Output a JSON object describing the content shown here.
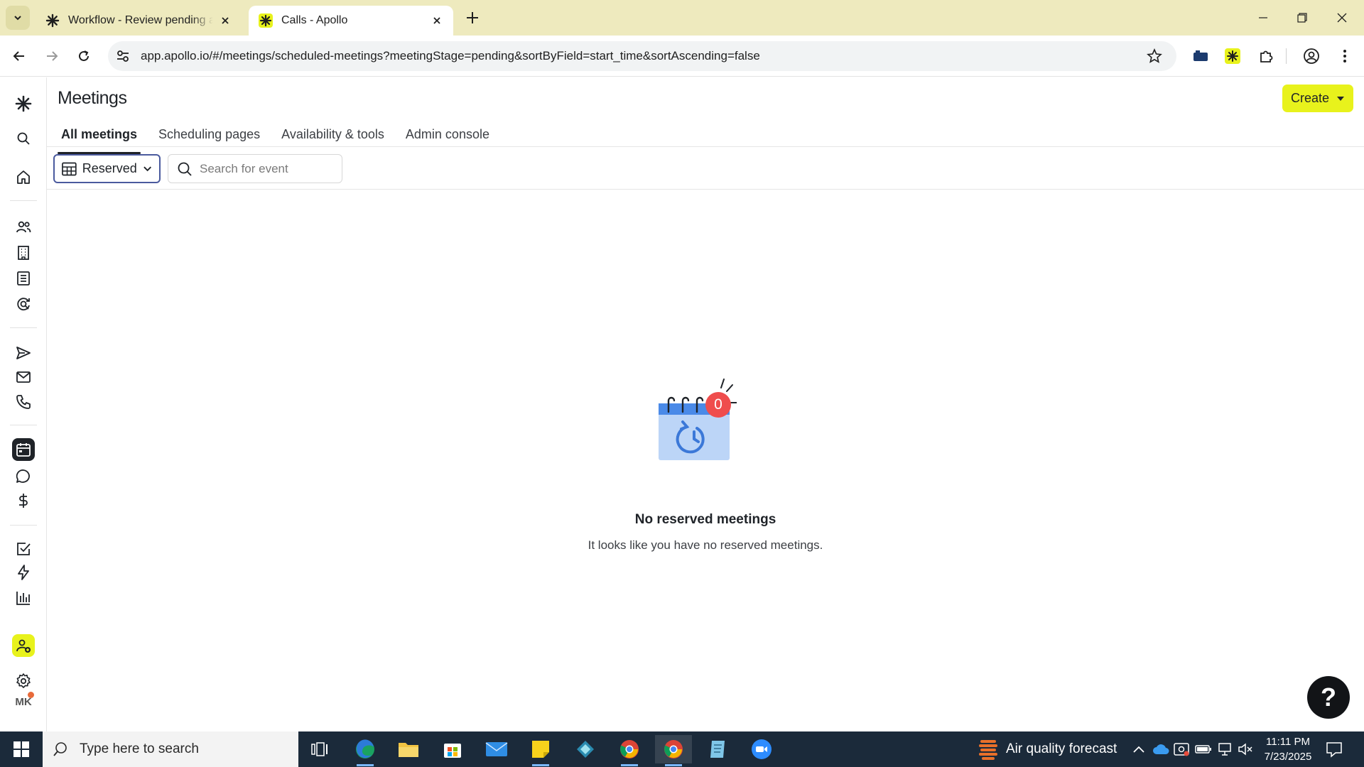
{
  "browser": {
    "tabs": [
      {
        "title": "Workflow - Review pending app",
        "active": false
      },
      {
        "title": "Calls - Apollo",
        "active": true
      }
    ],
    "url": "app.apollo.io/#/meetings/scheduled-meetings?meetingStage=pending&sortByField=start_time&sortAscending=false"
  },
  "sidebar": {
    "items": [
      {
        "icon": "apollo-logo-icon"
      },
      {
        "icon": "search-icon"
      },
      {
        "icon": "home-icon"
      },
      {
        "icon": "people-icon"
      },
      {
        "icon": "companies-icon"
      },
      {
        "icon": "lists-icon"
      },
      {
        "icon": "data-enrichment-icon"
      },
      {
        "icon": "sequences-icon"
      },
      {
        "icon": "emails-icon"
      },
      {
        "icon": "calls-icon"
      },
      {
        "icon": "meetings-icon",
        "active": true
      },
      {
        "icon": "conversations-icon"
      },
      {
        "icon": "deals-icon"
      },
      {
        "icon": "tasks-icon"
      },
      {
        "icon": "workflows-icon"
      },
      {
        "icon": "analytics-icon"
      },
      {
        "icon": "invite-user-icon"
      },
      {
        "icon": "settings-icon"
      }
    ],
    "avatar_initials": "MK"
  },
  "page": {
    "title": "Meetings",
    "create_label": "Create",
    "tabs": [
      {
        "label": "All meetings",
        "active": true
      },
      {
        "label": "Scheduling pages"
      },
      {
        "label": "Availability & tools"
      },
      {
        "label": "Admin console"
      }
    ],
    "view_select": "Reserved",
    "search_placeholder": "Search for event",
    "empty_state": {
      "badge_count": "0",
      "title": "No reserved meetings",
      "subtitle": "It looks like you have no reserved meetings."
    },
    "help_label": "?"
  },
  "taskbar": {
    "search_placeholder": "Type here to search",
    "weather": "Air quality forecast",
    "time": "11:11 PM",
    "date": "7/23/2025"
  },
  "colors": {
    "accent": "#e8f21c",
    "tabbar": "#eeeabe",
    "taskbar": "#1b2a3a",
    "badge": "#ef4d4d",
    "calendar_blue": "#4a8ae8"
  }
}
